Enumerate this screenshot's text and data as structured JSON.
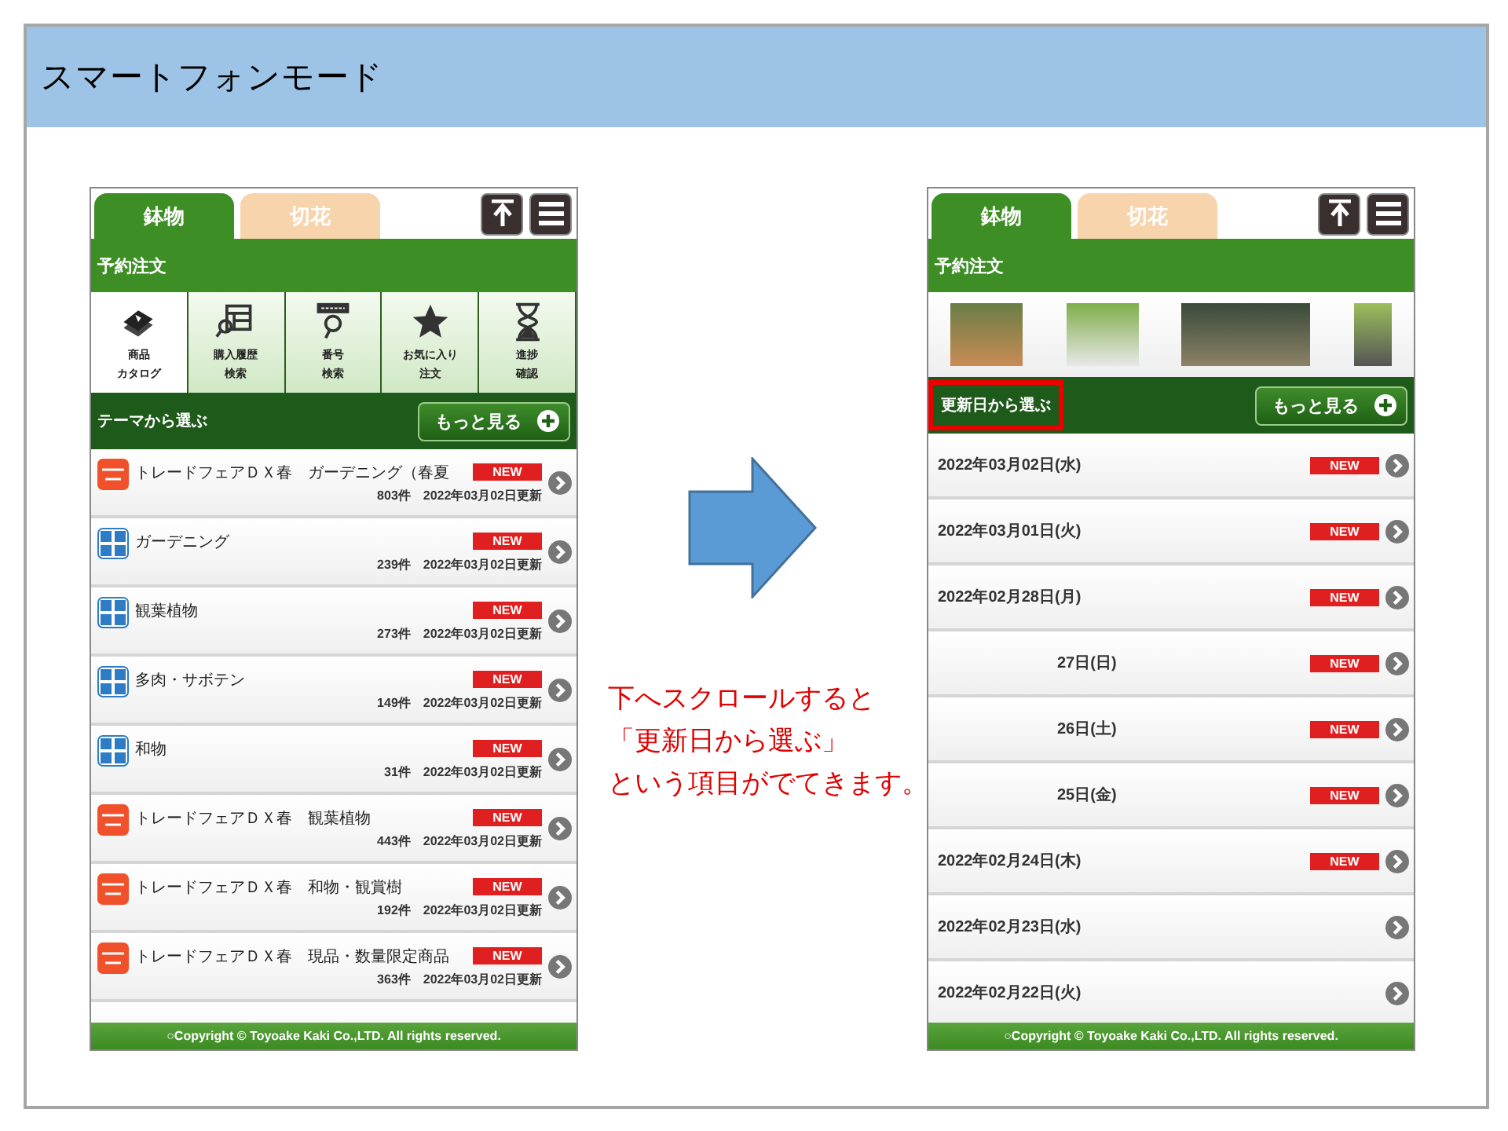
{
  "slide": {
    "title": "スマートフォンモード"
  },
  "left_phone": {
    "tabs": [
      {
        "label": "鉢物",
        "selected": true
      },
      {
        "label": "切花",
        "selected": false
      }
    ],
    "header": "予約注文",
    "menu": [
      {
        "kind": "catalog",
        "lines": [
          "商品",
          "カタログ"
        ],
        "selected": true
      },
      {
        "kind": "history",
        "lines": [
          "購入履歴",
          "検索"
        ],
        "selected": false
      },
      {
        "kind": "number",
        "lines": [
          "番号",
          "検索"
        ],
        "selected": false
      },
      {
        "kind": "favorite",
        "lines": [
          "お気に入り",
          "注文"
        ],
        "selected": false
      },
      {
        "kind": "progress",
        "lines": [
          "進捗",
          "確認"
        ],
        "selected": false
      }
    ],
    "section": {
      "title": "テーマから選ぶ",
      "button": "もっと見る"
    },
    "rows": [
      {
        "kind": "trade_fair",
        "title": "トレードフェアＤＸ春　ガーデニング（春夏",
        "badge": "NEW",
        "new": true,
        "count": "803件",
        "updated": "2022年03月02日更新"
      },
      {
        "kind": "origin",
        "title": "ガーデニング",
        "badge": "NEW",
        "new": true,
        "count": "239件",
        "updated": "2022年03月02日更新"
      },
      {
        "kind": "origin",
        "title": "観葉植物",
        "badge": "NEW",
        "new": true,
        "count": "273件",
        "updated": "2022年03月02日更新"
      },
      {
        "kind": "origin",
        "title": "多肉・サボテン",
        "badge": "NEW",
        "new": true,
        "count": "149件",
        "updated": "2022年03月02日更新"
      },
      {
        "kind": "origin",
        "title": "和物",
        "badge": "NEW",
        "new": true,
        "count": "31件",
        "updated": "2022年03月02日更新"
      },
      {
        "kind": "trade_fair",
        "title": "トレードフェアＤＸ春　観葉植物",
        "badge": "NEW",
        "new": true,
        "count": "443件",
        "updated": "2022年03月02日更新"
      },
      {
        "kind": "trade_fair",
        "title": "トレードフェアＤＸ春　和物・観賞樹",
        "badge": "NEW",
        "new": true,
        "count": "192件",
        "updated": "2022年03月02日更新"
      },
      {
        "kind": "trade_fair",
        "title": "トレードフェアＤＸ春　現品・数量限定商品",
        "badge": "NEW",
        "new": true,
        "count": "363件",
        "updated": "2022年03月02日更新"
      }
    ],
    "footer": "○Copyright © Toyoake Kaki Co.,LTD. All rights reserved."
  },
  "callout": [
    "下へスクロールすると",
    "「更新日から選ぶ」",
    "という項目がでてきます。"
  ],
  "right_phone": {
    "tabs": [
      {
        "label": "鉢物",
        "selected": true
      },
      {
        "label": "切花",
        "selected": false
      }
    ],
    "header": "予約注文",
    "section": {
      "title": "更新日から選ぶ",
      "button": "もっと見る",
      "highlighted": true
    },
    "rows": [
      {
        "date": "2022年03月02日(水)",
        "badge": "NEW",
        "new": true,
        "obscured": false
      },
      {
        "date": "2022年03月01日(火)",
        "badge": "NEW",
        "new": true,
        "obscured": false
      },
      {
        "date": "2022年02月28日(月)",
        "badge": "NEW",
        "new": true,
        "obscured": false
      },
      {
        "date": "27日(日)",
        "badge": "NEW",
        "new": true,
        "obscured": true
      },
      {
        "date": "26日(土)",
        "badge": "NEW",
        "new": true,
        "obscured": true
      },
      {
        "date": "25日(金)",
        "badge": "NEW",
        "new": true,
        "obscured": true
      },
      {
        "date": "2022年02月24日(木)",
        "badge": "NEW",
        "new": true,
        "obscured": false
      },
      {
        "date": "2022年02月23日(水)",
        "new": false,
        "obscured": false
      },
      {
        "date": "2022年02月22日(火)",
        "new": false,
        "obscured": false
      }
    ],
    "footer": "○Copyright © Toyoake Kaki Co.,LTD. All rights reserved."
  }
}
